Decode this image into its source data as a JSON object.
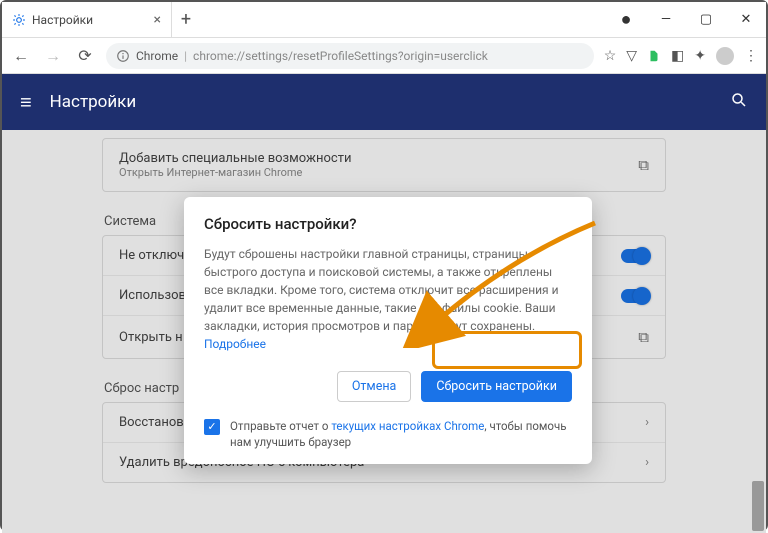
{
  "window": {
    "tab_title": "Настройки",
    "url_host": "Chrome",
    "url_prefix": "chrome://",
    "url_path": "settings/resetProfileSettings?origin=userclick"
  },
  "settings_header": {
    "title": "Настройки"
  },
  "page": {
    "accessibility": {
      "title": "Добавить специальные возможности",
      "sub": "Открыть Интернет-магазин Chrome"
    },
    "system_label": "Система",
    "system_rows": {
      "row1": "Не отключ",
      "row2": "Использов",
      "row3": "Открыть н"
    },
    "reset_label": "Сброс настр",
    "reset_rows": {
      "row1": "Восстановление настроек по умолчанию",
      "row2": "Удалить вредоносное ПО с компьютера"
    }
  },
  "dialog": {
    "title": "Сбросить настройки?",
    "body": "Будут сброшены настройки главной страницы, страницы быстрого доступа и поисковой системы, а также откреплены все вкладки. Кроме того, система отключит все расширения и удалит все временные данные, такие как файлы cookie. Ваши закладки, история просмотров и пароли будут сохранены.",
    "learn_more": "Подробнее",
    "cancel": "Отмена",
    "confirm": "Сбросить настройки",
    "report_prefix": "Отправьте отчет о ",
    "report_link": "текущих настройках Chrome",
    "report_suffix": ", чтобы помочь нам улучшить браузер"
  }
}
